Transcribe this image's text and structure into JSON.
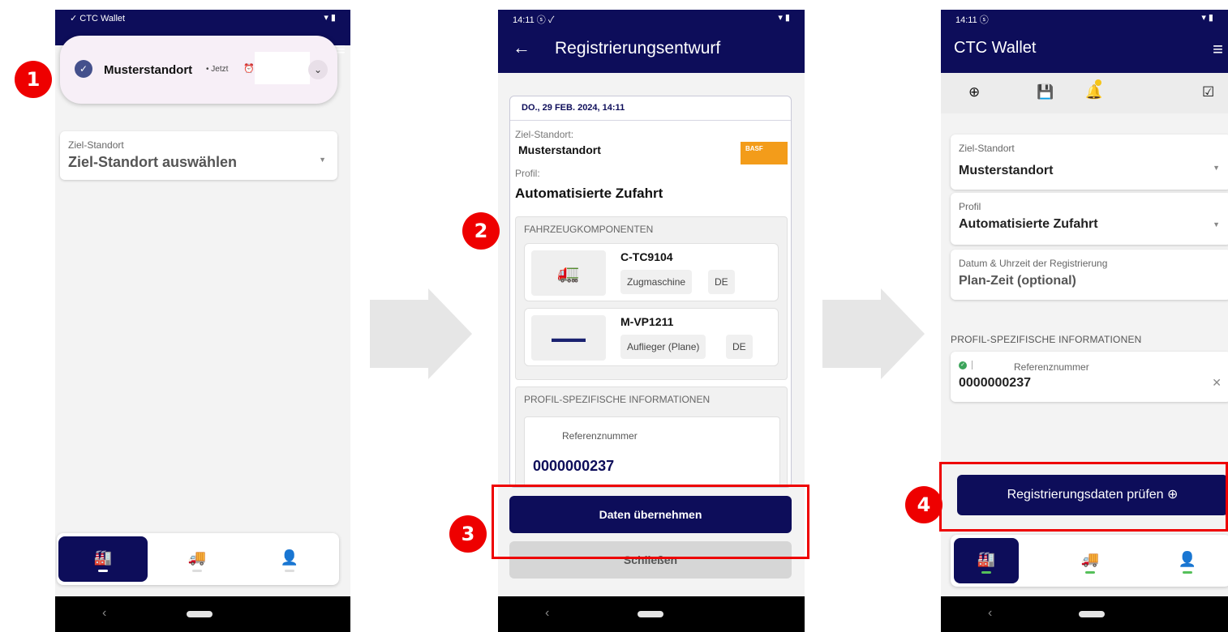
{
  "phone1": {
    "status_app": "CTC Wallet",
    "notification": {
      "title": "Musterstandort",
      "time": "• Jetzt"
    },
    "field": {
      "label": "Ziel-Standort",
      "value": "Ziel-Standort auswählen"
    }
  },
  "phone2": {
    "status_time": "14:11",
    "title": "Registrierungsentwurf",
    "date": "DO., 29 FEB. 2024, 14:11",
    "target_label": "Ziel-Standort:",
    "target_value": "Musterstandort",
    "brand": "BASF",
    "profile_label": "Profil:",
    "profile_value": "Automatisierte Zufahrt",
    "vehicle_section": "FAHRZEUGKOMPONENTEN",
    "vehicles": [
      {
        "plate": "C-TC9104",
        "type": "Zugmaschine",
        "country": "DE"
      },
      {
        "plate": "M-VP1211",
        "type": "Auflieger (Plane)",
        "country": "DE"
      }
    ],
    "profile_section": "PROFIL-SPEZIFISCHE INFORMATIONEN",
    "ref_label": "Referenznummer",
    "ref_value": "0000000237",
    "btn_accept": "Daten übernehmen",
    "btn_close": "Schließen"
  },
  "phone3": {
    "status_time": "14:11",
    "title": "CTC Wallet",
    "fields": [
      {
        "label": "Ziel-Standort",
        "value": "Musterstandort"
      },
      {
        "label": "Profil",
        "value": "Automatisierte Zufahrt"
      },
      {
        "label": "Datum & Uhrzeit der Registrierung",
        "value": "Plan-Zeit (optional)"
      }
    ],
    "profile_section": "PROFIL-SPEZIFISCHE INFORMATIONEN",
    "ref_label": "Referenznummer",
    "ref_value": "0000000237",
    "btn_check": "Registrierungsdaten prüfen"
  },
  "steps": [
    "1",
    "2",
    "3",
    "4"
  ],
  "colors": {
    "primary": "#0d0d5a",
    "highlight": "#e00000",
    "badge": "#f5c518",
    "ok": "#3ba45a"
  },
  "icons": [
    "add-icon",
    "save-icon",
    "bell-icon",
    "checklist-icon",
    "factory-icon",
    "truck-icon",
    "person-icon",
    "globe-icon"
  ]
}
